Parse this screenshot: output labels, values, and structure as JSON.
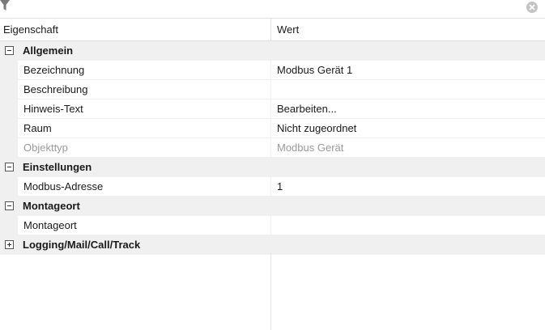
{
  "header": {
    "property": "Eigenschaft",
    "value": "Wert"
  },
  "categories": [
    {
      "label": "Allgemein",
      "expanded": true,
      "rows": [
        {
          "name": "Bezeichnung",
          "value": "Modbus Gerät 1",
          "readonly": false
        },
        {
          "name": "Beschreibung",
          "value": "",
          "readonly": false
        },
        {
          "name": "Hinweis-Text",
          "value": "Bearbeiten...",
          "readonly": false
        },
        {
          "name": "Raum",
          "value": "Nicht zugeordnet",
          "readonly": false
        },
        {
          "name": "Objekttyp",
          "value": "Modbus Gerät",
          "readonly": true
        }
      ]
    },
    {
      "label": "Einstellungen",
      "expanded": true,
      "rows": [
        {
          "name": "Modbus-Adresse",
          "value": "1",
          "readonly": false
        }
      ]
    },
    {
      "label": "Montageort",
      "expanded": true,
      "rows": [
        {
          "name": "Montageort",
          "value": "",
          "readonly": false
        }
      ]
    },
    {
      "label": "Logging/Mail/Call/Track",
      "expanded": false,
      "rows": []
    }
  ],
  "icons": {
    "filter": "filter-icon",
    "clear": "clear-icon"
  },
  "colors": {
    "category_bg": "#f0f0f0",
    "readonly_text": "#9a9a9a"
  }
}
